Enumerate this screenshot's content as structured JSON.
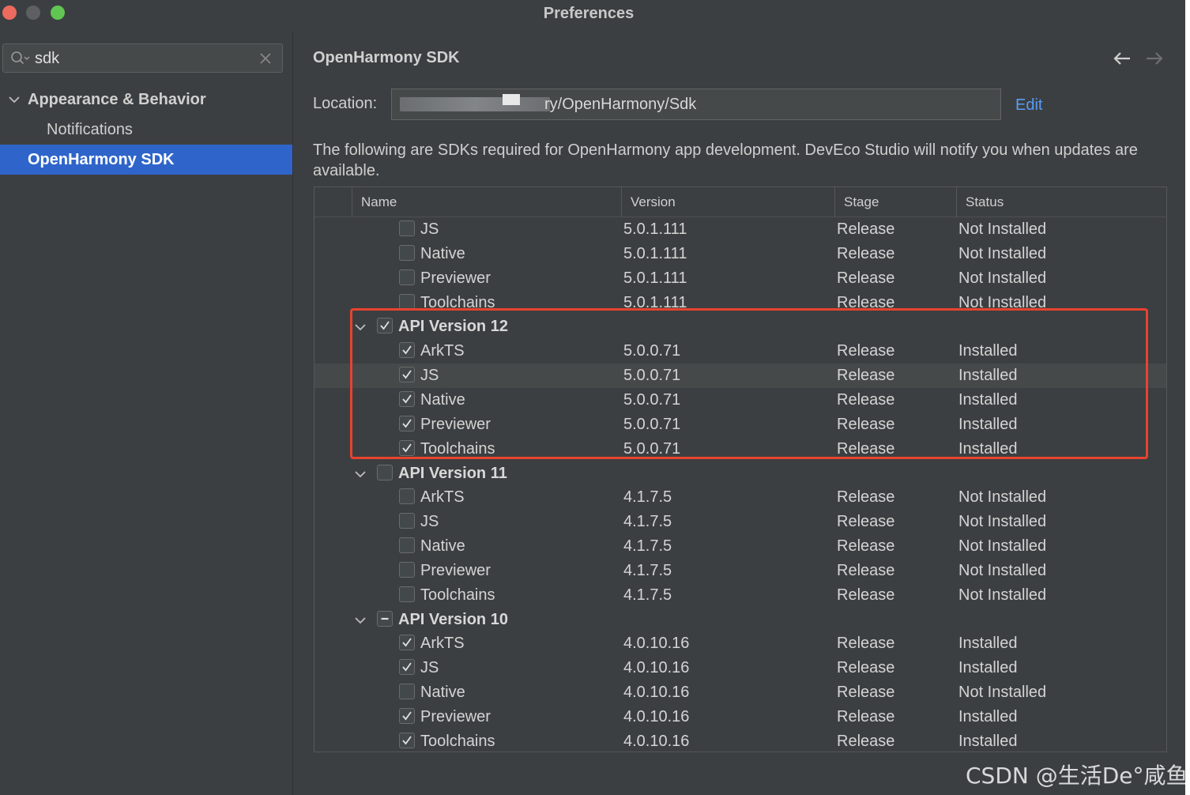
{
  "window": {
    "title": "Preferences"
  },
  "sidebar": {
    "search": {
      "value": "sdk",
      "placeholder": ""
    },
    "items": [
      {
        "label": "Appearance & Behavior"
      },
      {
        "label": "Notifications"
      },
      {
        "label": "OpenHarmony SDK"
      }
    ]
  },
  "content": {
    "title": "OpenHarmony SDK",
    "location_label": "Location:",
    "location_value": "ry/OpenHarmony/Sdk",
    "edit_label": "Edit",
    "description": "The following are SDKs required for OpenHarmony app development. DevEco Studio will notify you when updates are available."
  },
  "table": {
    "headers": {
      "name": "Name",
      "version": "Version",
      "stage": "Stage",
      "status": "Status"
    },
    "rows": [
      {
        "name": "JS",
        "version": "5.0.1.111",
        "stage": "Release",
        "status": "Not Installed"
      },
      {
        "name": "Native",
        "version": "5.0.1.111",
        "stage": "Release",
        "status": "Not Installed"
      },
      {
        "name": "Previewer",
        "version": "5.0.1.111",
        "stage": "Release",
        "status": "Not Installed"
      },
      {
        "name": "Toolchains",
        "version": "5.0.1.111",
        "stage": "Release",
        "status": "Not Installed"
      },
      {
        "name": "API Version 12"
      },
      {
        "name": "ArkTS",
        "version": "5.0.0.71",
        "stage": "Release",
        "status": "Installed"
      },
      {
        "name": "JS",
        "version": "5.0.0.71",
        "stage": "Release",
        "status": "Installed"
      },
      {
        "name": "Native",
        "version": "5.0.0.71",
        "stage": "Release",
        "status": "Installed"
      },
      {
        "name": "Previewer",
        "version": "5.0.0.71",
        "stage": "Release",
        "status": "Installed"
      },
      {
        "name": "Toolchains",
        "version": "5.0.0.71",
        "stage": "Release",
        "status": "Installed"
      },
      {
        "name": "API Version 11"
      },
      {
        "name": "ArkTS",
        "version": "4.1.7.5",
        "stage": "Release",
        "status": "Not Installed"
      },
      {
        "name": "JS",
        "version": "4.1.7.5",
        "stage": "Release",
        "status": "Not Installed"
      },
      {
        "name": "Native",
        "version": "4.1.7.5",
        "stage": "Release",
        "status": "Not Installed"
      },
      {
        "name": "Previewer",
        "version": "4.1.7.5",
        "stage": "Release",
        "status": "Not Installed"
      },
      {
        "name": "Toolchains",
        "version": "4.1.7.5",
        "stage": "Release",
        "status": "Not Installed"
      },
      {
        "name": "API Version 10"
      },
      {
        "name": "ArkTS",
        "version": "4.0.10.16",
        "stage": "Release",
        "status": "Installed"
      },
      {
        "name": "JS",
        "version": "4.0.10.16",
        "stage": "Release",
        "status": "Installed"
      },
      {
        "name": "Native",
        "version": "4.0.10.16",
        "stage": "Release",
        "status": "Not Installed"
      },
      {
        "name": "Previewer",
        "version": "4.0.10.16",
        "stage": "Release",
        "status": "Installed"
      },
      {
        "name": "Toolchains",
        "version": "4.0.10.16",
        "stage": "Release",
        "status": "Installed"
      }
    ]
  },
  "watermark": "CSDN @生活De°咸鱼",
  "colors": {
    "accent": "#2f65ca",
    "link": "#589df6",
    "highlight": "#e8432f"
  }
}
